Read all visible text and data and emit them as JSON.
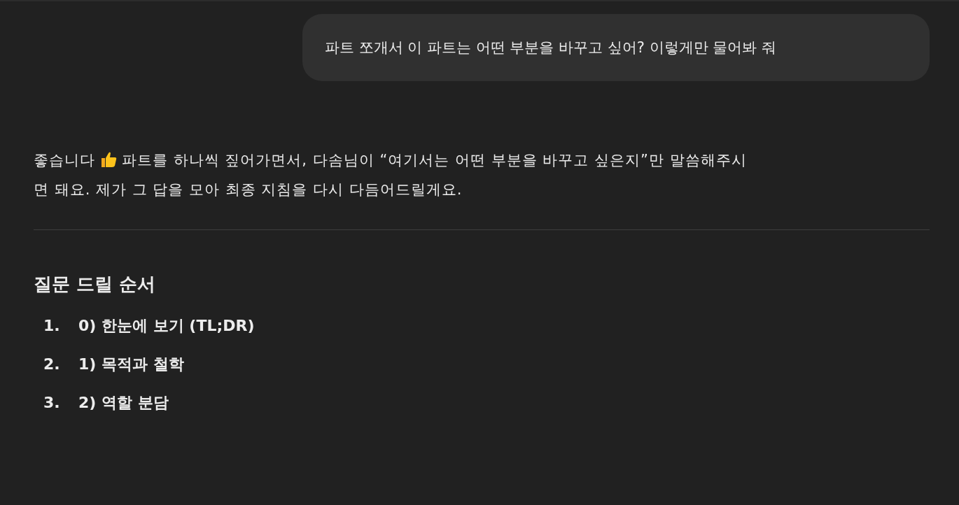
{
  "user_message": "파트 쪼개서 이 파트는 어떤 부분을 바꾸고 싶어? 이렇게만 물어봐 줘",
  "reply": {
    "intro_start": "좋습니다",
    "intro_rest": "파트를 하나씩 짚어가면서, 다솜님이 “여기서는 어떤 부분을 바꾸고 싶은지”만 말씀해주시",
    "intro_end": "면 돼요. 제가 그 답을 모아 최종 지침을 다시 다듬어드릴게요.",
    "heading": "질문 드릴 순서",
    "steps": [
      {
        "number": "1.",
        "text": "0) 한눈에 보기 (TL;DR)"
      },
      {
        "number": "2.",
        "text": "1) 목적과 철학"
      },
      {
        "number": "3.",
        "text": "2) 역할 분담"
      }
    ]
  }
}
